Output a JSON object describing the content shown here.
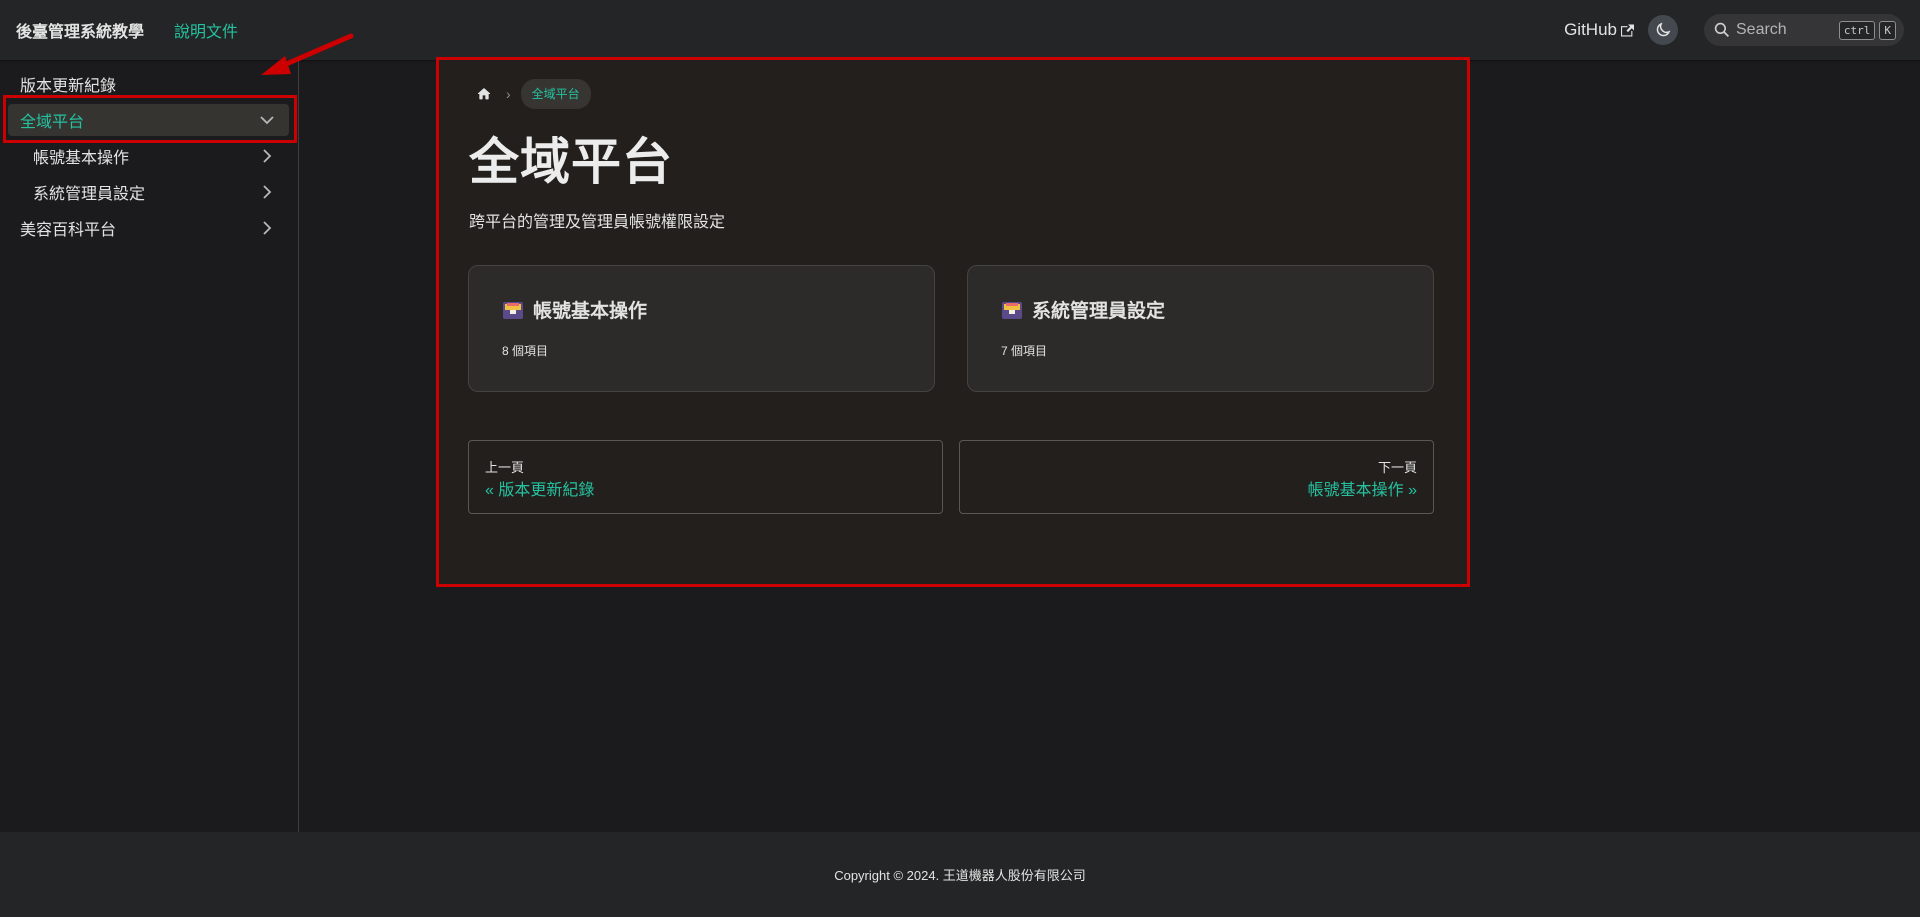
{
  "navbar": {
    "brand": "後臺管理系統教學",
    "docs_link": "說明文件",
    "github": "GitHub",
    "search_label": "Search",
    "kbd_ctrl": "ctrl",
    "kbd_k": "K"
  },
  "sidebar": {
    "items": [
      {
        "label": "版本更新紀錄"
      },
      {
        "label": "全域平台"
      },
      {
        "label": "帳號基本操作"
      },
      {
        "label": "系統管理員設定"
      },
      {
        "label": "美容百科平台"
      }
    ]
  },
  "main": {
    "breadcrumb_active": "全域平台",
    "title": "全域平台",
    "description": "跨平台的管理及管理員帳號權限設定",
    "cards": [
      {
        "title": "帳號基本操作",
        "count": "8 個項目"
      },
      {
        "title": "系統管理員設定",
        "count": "7 個項目"
      }
    ],
    "pager": {
      "prev_sub": "上一頁",
      "prev_label": "« 版本更新紀錄",
      "next_sub": "下一頁",
      "next_label": "帳號基本操作 »"
    }
  },
  "footer": {
    "copyright": "Copyright © 2024. 王道機器人股份有限公司"
  },
  "colors": {
    "accent": "#25c2a0",
    "annotation": "#cc0000"
  }
}
